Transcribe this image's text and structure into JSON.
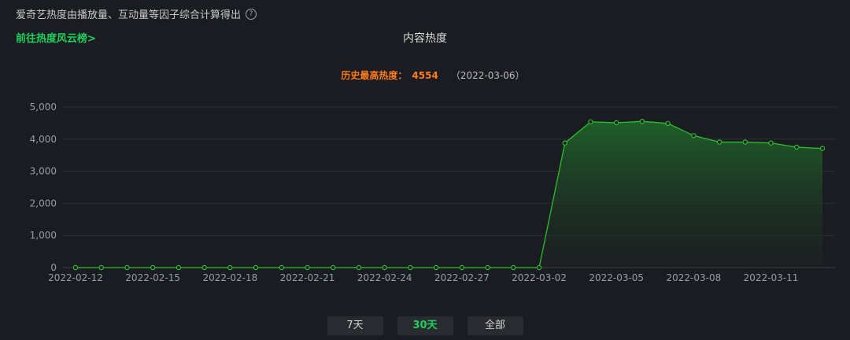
{
  "info": {
    "text": "爱奇艺热度由播放量、互动量等因子综合计算得出",
    "help_icon": "question-circle-icon"
  },
  "link": {
    "label": "前往热度风云榜>"
  },
  "chart_title": "内容热度",
  "peak": {
    "label": "历史最高热度：",
    "value": "4554",
    "date": "（2022-03-06）"
  },
  "buttons": [
    {
      "label": "7天",
      "active": false
    },
    {
      "label": "30天",
      "active": true
    },
    {
      "label": "全部",
      "active": false
    }
  ],
  "colors": {
    "line": "#2dbd2d",
    "accent": "#1fd15c",
    "peak": "#ff7a1a"
  },
  "chart_data": {
    "type": "area",
    "title": "内容热度",
    "x": [
      "2022-02-12",
      "2022-02-13",
      "2022-02-14",
      "2022-02-15",
      "2022-02-16",
      "2022-02-17",
      "2022-02-18",
      "2022-02-19",
      "2022-02-20",
      "2022-02-21",
      "2022-02-22",
      "2022-02-23",
      "2022-02-24",
      "2022-02-25",
      "2022-02-26",
      "2022-02-27",
      "2022-02-28",
      "2022-03-01",
      "2022-03-02",
      "2022-03-03",
      "2022-03-04",
      "2022-03-05",
      "2022-03-06",
      "2022-03-07",
      "2022-03-08",
      "2022-03-09",
      "2022-03-10",
      "2022-03-11",
      "2022-03-12",
      "2022-03-13"
    ],
    "x_tick_labels": [
      "2022-02-12",
      "2022-02-15",
      "2022-02-18",
      "2022-02-21",
      "2022-02-24",
      "2022-02-27",
      "2022-03-02",
      "2022-03-05",
      "2022-03-08",
      "2022-03-11"
    ],
    "values": [
      0,
      0,
      0,
      0,
      0,
      0,
      0,
      0,
      0,
      0,
      0,
      0,
      0,
      0,
      0,
      0,
      0,
      0,
      0,
      3880,
      4540,
      4510,
      4554,
      4490,
      4110,
      3910,
      3910,
      3880,
      3750,
      3710
    ],
    "y_ticks": [
      "0",
      "1,000",
      "2,000",
      "3,000",
      "4,000",
      "5,000"
    ],
    "ylim": [
      0,
      5000
    ],
    "grid": true
  }
}
